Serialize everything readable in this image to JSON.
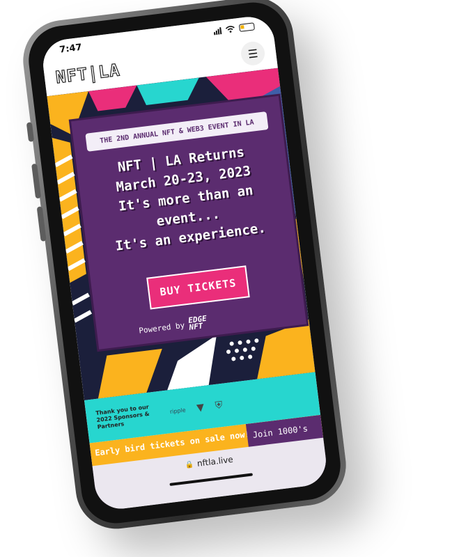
{
  "status_bar": {
    "time": "7:47"
  },
  "header": {
    "logo": "NFT|LA",
    "menu_icon": "hamburger-icon"
  },
  "hero": {
    "tagline": "THE 2ND ANNUAL NFT & WEB3 EVENT IN LA",
    "headline_lines": [
      "NFT | LA Returns",
      "March 20-23, 2023",
      "It's more than an",
      "event...",
      "It's an experience."
    ],
    "cta_label": "BUY TICKETS",
    "powered_by": "Powered by",
    "powered_brand_line1": "EDGE",
    "powered_brand_line2": "NFT"
  },
  "sponsors": {
    "thanks_text": "Thank you to our 2022 Sponsors & Partners",
    "logos": [
      "ripple"
    ]
  },
  "ticker": {
    "text": "Early bird tickets on sale now!",
    "join_text": "Join 1000's"
  },
  "url_bar": {
    "url": "nftla.live"
  },
  "colors": {
    "purple": "#5b2c6f",
    "pink": "#ea2e7a",
    "teal": "#27d6cf",
    "yellow": "#fbb31e",
    "navy": "#1b1f3b"
  }
}
